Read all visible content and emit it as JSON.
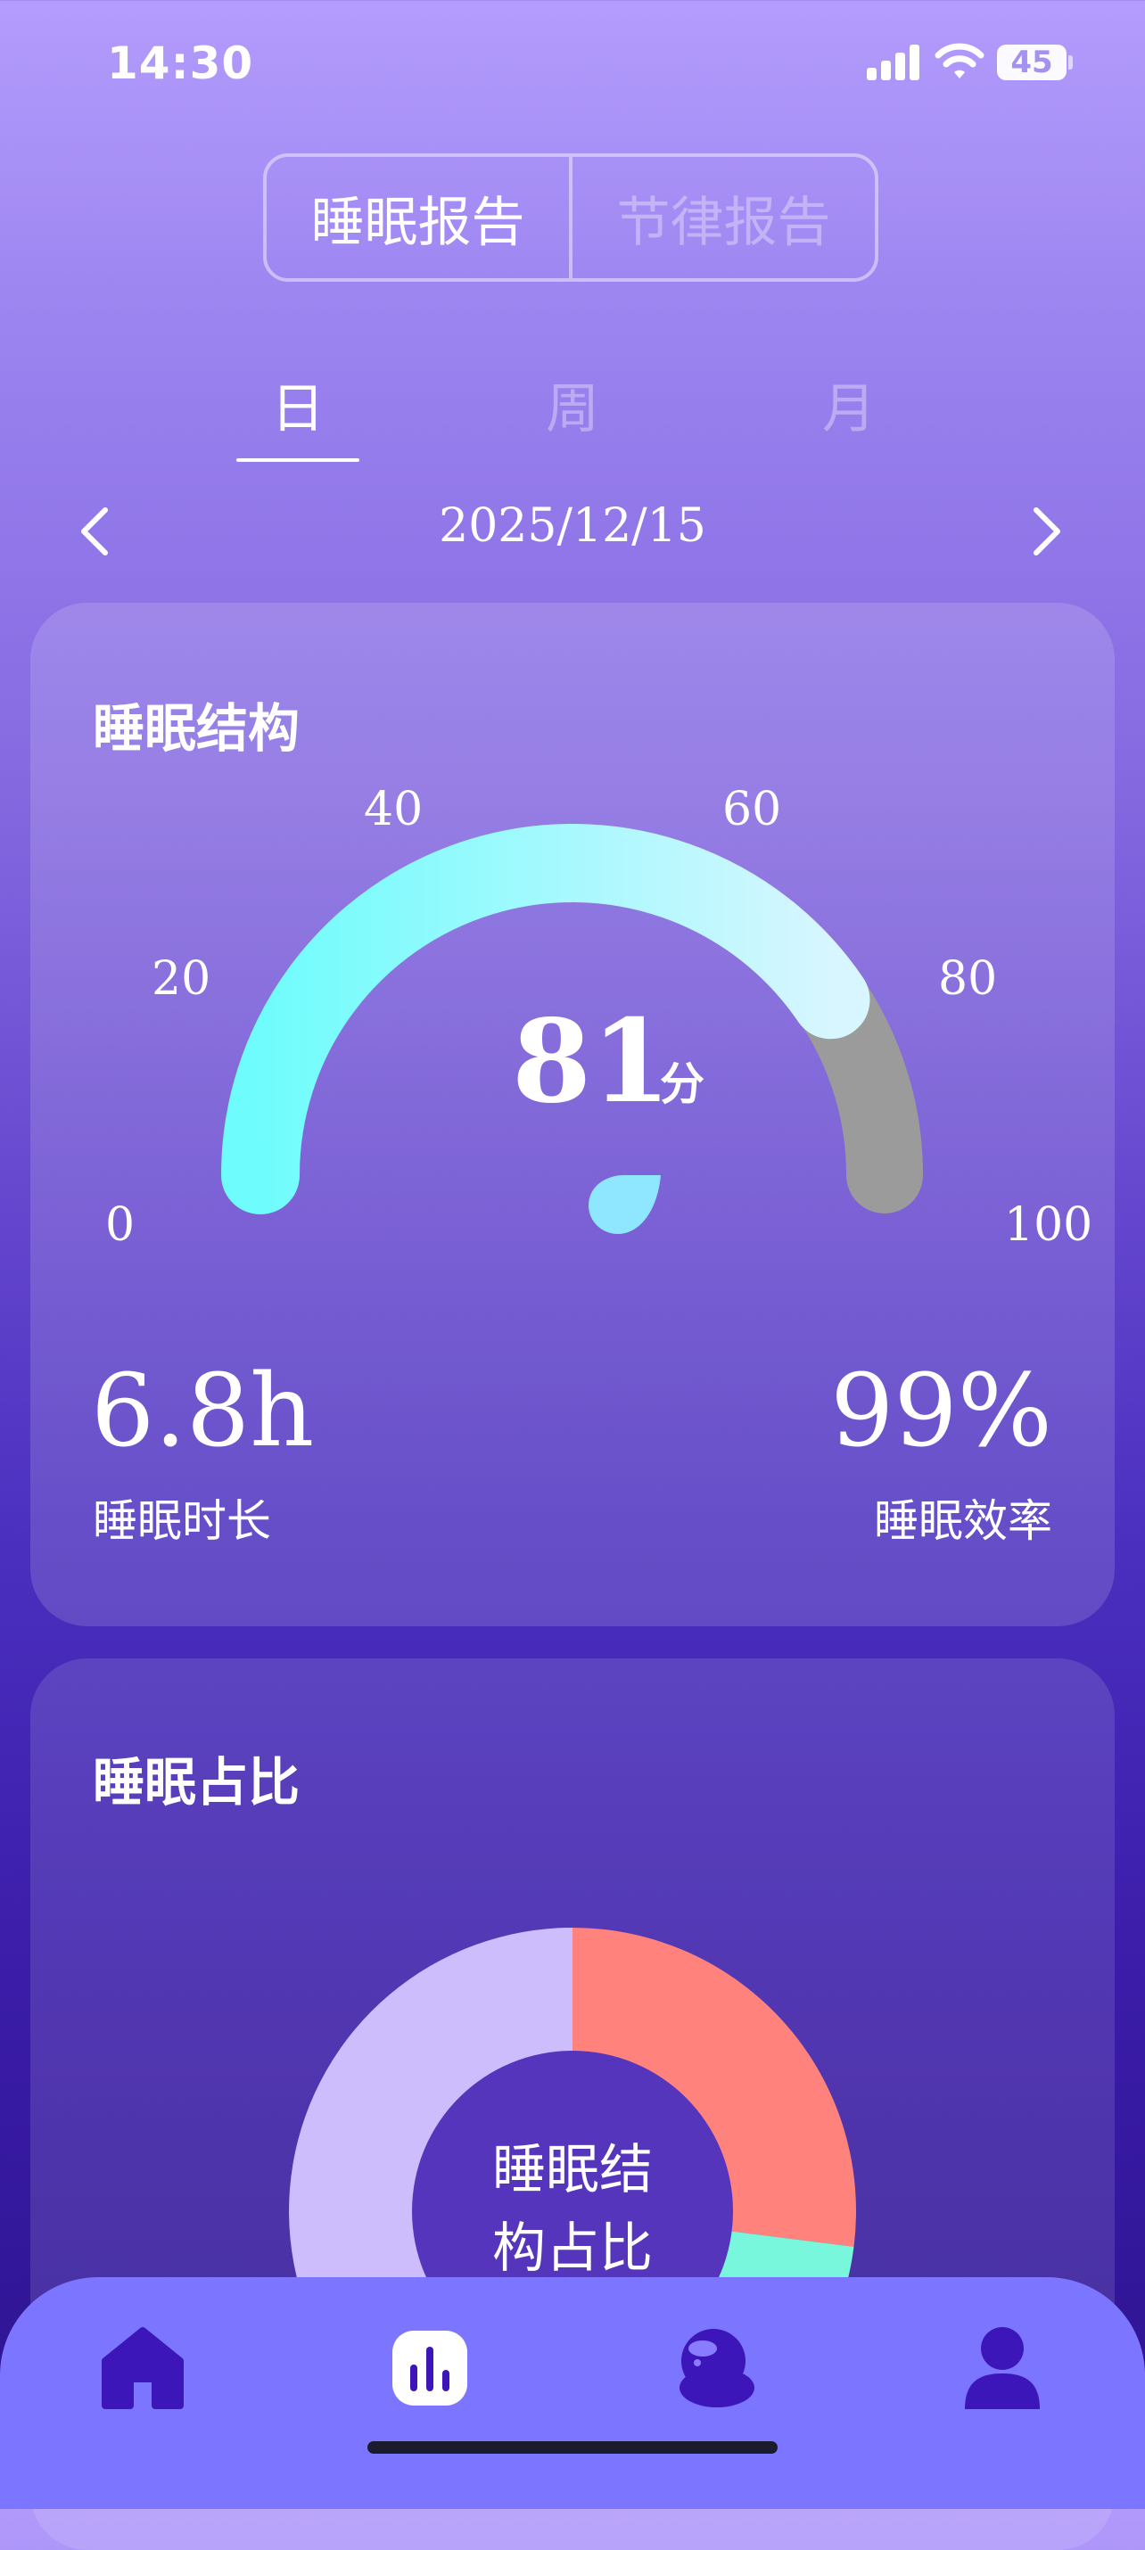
{
  "status_bar": {
    "time": "14:30",
    "battery": "45"
  },
  "report_tabs": {
    "sleep_report": "睡眠报告",
    "rhythm_report": "节律报告"
  },
  "period_tabs": {
    "day": "日",
    "week": "周",
    "month": "月",
    "selected": "日"
  },
  "date": "2025/12/15",
  "sleep_structure": {
    "title": "睡眠结构",
    "gauge": {
      "score": "81",
      "unit": "分",
      "ticks": [
        "0",
        "20",
        "40",
        "60",
        "80",
        "100"
      ],
      "score_fraction": 0.81,
      "colors": {
        "start": "#6ffcfc",
        "end": "#d7f6ff",
        "track": "#9b9b9b"
      }
    },
    "duration_value": "6.8h",
    "duration_label": "睡眠时长",
    "efficiency_value": "99%",
    "efficiency_label": "睡眠效率"
  },
  "sleep_ratio": {
    "title": "睡眠占比",
    "center_label_line1": "睡眠结",
    "center_label_line2": "构占比",
    "segments": [
      {
        "color": "#ff827c",
        "fraction": 0.27
      },
      {
        "color": "#79f7dc",
        "fraction": 0.06
      },
      {
        "color": "#cdbdfd",
        "fraction": 0.67
      }
    ]
  },
  "bottom_nav": {
    "items": [
      {
        "icon": "home-icon",
        "active": false
      },
      {
        "icon": "report-icon",
        "active": true
      },
      {
        "icon": "device-icon",
        "active": false
      },
      {
        "icon": "profile-icon",
        "active": false
      }
    ],
    "colors": {
      "background": "#7c75ff",
      "icon": "#3c16b8"
    }
  }
}
